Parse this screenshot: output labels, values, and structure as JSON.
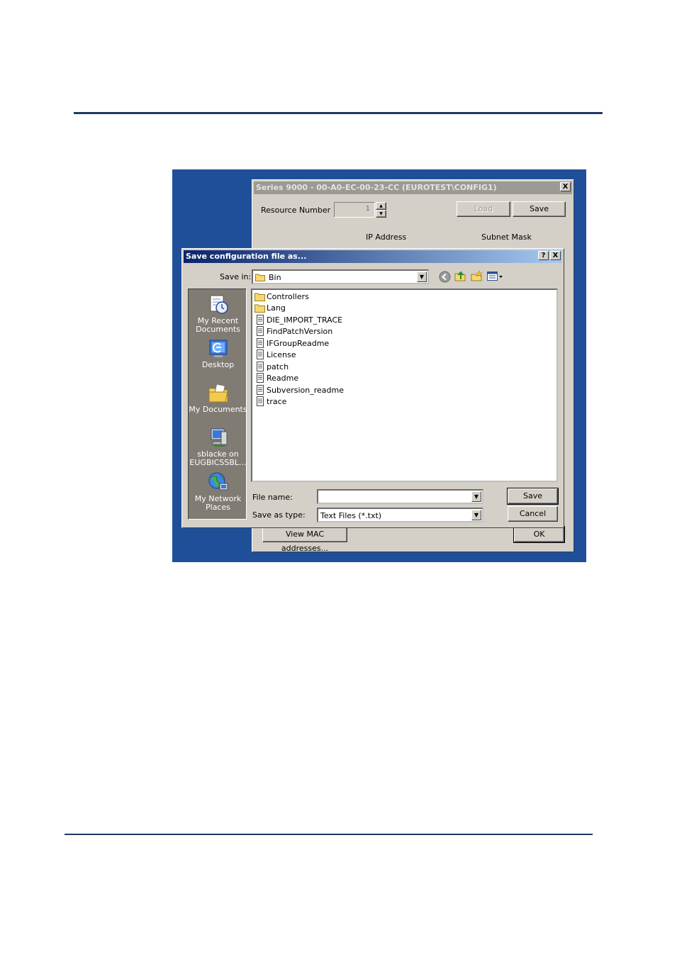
{
  "parent_window": {
    "title": "Series 9000 - 00-A0-EC-00-23-CC (EUROTEST\\CONFIG1)",
    "close_symbol": "X",
    "resource_number_label": "Resource Number",
    "resource_number_value": "1",
    "load_label": "Load",
    "save_label": "Save",
    "col_ip": "IP Address",
    "col_subnet": "Subnet Mask",
    "view_mac_label": "View MAC addresses...",
    "ok_label": "OK"
  },
  "dialog": {
    "title": "Save configuration file as...",
    "help_symbol": "?",
    "close_symbol": "X",
    "save_in_label": "Save in:",
    "save_in_value": "Bin",
    "places": [
      {
        "line1": "My Recent",
        "line2": "Documents",
        "icon": "recent-documents-icon"
      },
      {
        "line1": "Desktop",
        "line2": "",
        "icon": "desktop-icon"
      },
      {
        "line1": "My Documents",
        "line2": "",
        "icon": "my-documents-icon"
      },
      {
        "line1": "sblacke on",
        "line2": "EUGBICSSBL...",
        "icon": "network-drive-icon"
      },
      {
        "line1": "My Network",
        "line2": "Places",
        "icon": "network-places-icon"
      }
    ],
    "files": [
      {
        "name": "Controllers",
        "type": "folder"
      },
      {
        "name": "Lang",
        "type": "folder"
      },
      {
        "name": "DIE_IMPORT_TRACE",
        "type": "file"
      },
      {
        "name": "FindPatchVersion",
        "type": "file"
      },
      {
        "name": "IFGroupReadme",
        "type": "file"
      },
      {
        "name": "License",
        "type": "file"
      },
      {
        "name": "patch",
        "type": "file"
      },
      {
        "name": "Readme",
        "type": "file"
      },
      {
        "name": "Subversion_readme",
        "type": "file"
      },
      {
        "name": "trace",
        "type": "file"
      }
    ],
    "file_name_label": "File name:",
    "file_name_value": "",
    "save_as_type_label": "Save as type:",
    "save_as_type_value": "Text Files (*.txt)",
    "save_button": "Save",
    "cancel_button": "Cancel"
  },
  "colors": {
    "rule": "#1f3864",
    "desktop": "#1f4f99",
    "active_title": "#0a246a",
    "places_bar": "#807c74"
  }
}
